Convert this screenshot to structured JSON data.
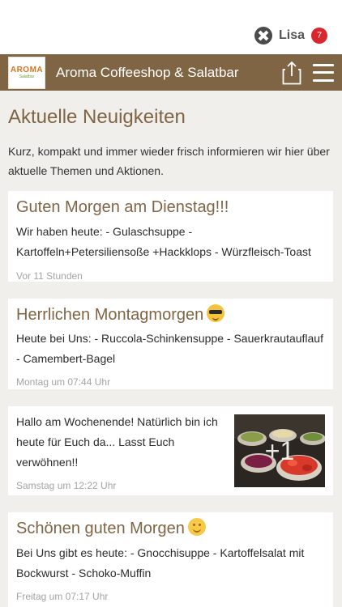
{
  "user": {
    "name": "Lisa",
    "badge_count": "7",
    "icon": "user-logo-icon"
  },
  "appbar": {
    "logo_text": "AROMA",
    "logo_sub": "Salatbar",
    "title": "Aroma Coffeeshop & Salatbar",
    "share_icon": "share-icon",
    "menu_icon": "hamburger-menu-icon"
  },
  "page": {
    "title": "Aktuelle Neuigkeiten",
    "intro": "Kurz, kompakt und immer wieder frisch informieren wir hier über aktuelle Themen und Aktionen."
  },
  "posts": [
    {
      "title": "Guten Morgen am Dienstag!!!",
      "body": "Wir haben heute: - Gulaschsuppe - Kartoffeln+Petersiliensoße +Hackklops - Würzfleisch-Toast",
      "time": "Vor 11 Stunden"
    },
    {
      "title": "Herrlichen Montagmorgen",
      "emoji": "sunglasses-emoji",
      "body": "Heute bei Uns: - Ruccola-Schinkensuppe - Sauerkrautauflauf - Camembert-Bagel",
      "time": "Montag um 07:44 Uhr"
    },
    {
      "body": "Hallo am Wochenende! Natürlich bin ich heute für Euch da... Lasst Euch verwöhnen!!",
      "time": "Samstag um 12:22 Uhr",
      "photo_more": "+1"
    },
    {
      "title": "Schönen guten Morgen",
      "emoji": "smiling-face-emoji",
      "body": "Bei Uns gibt es heute: - Gnocchisuppe - Kartoffelsalat mit Bockwurst - Schoko-Muffin",
      "time": "Freitag um 07:17 Uhr"
    }
  ],
  "colors": {
    "brand": "#806545",
    "background": "#f1efec",
    "badge": "#d9262c"
  }
}
